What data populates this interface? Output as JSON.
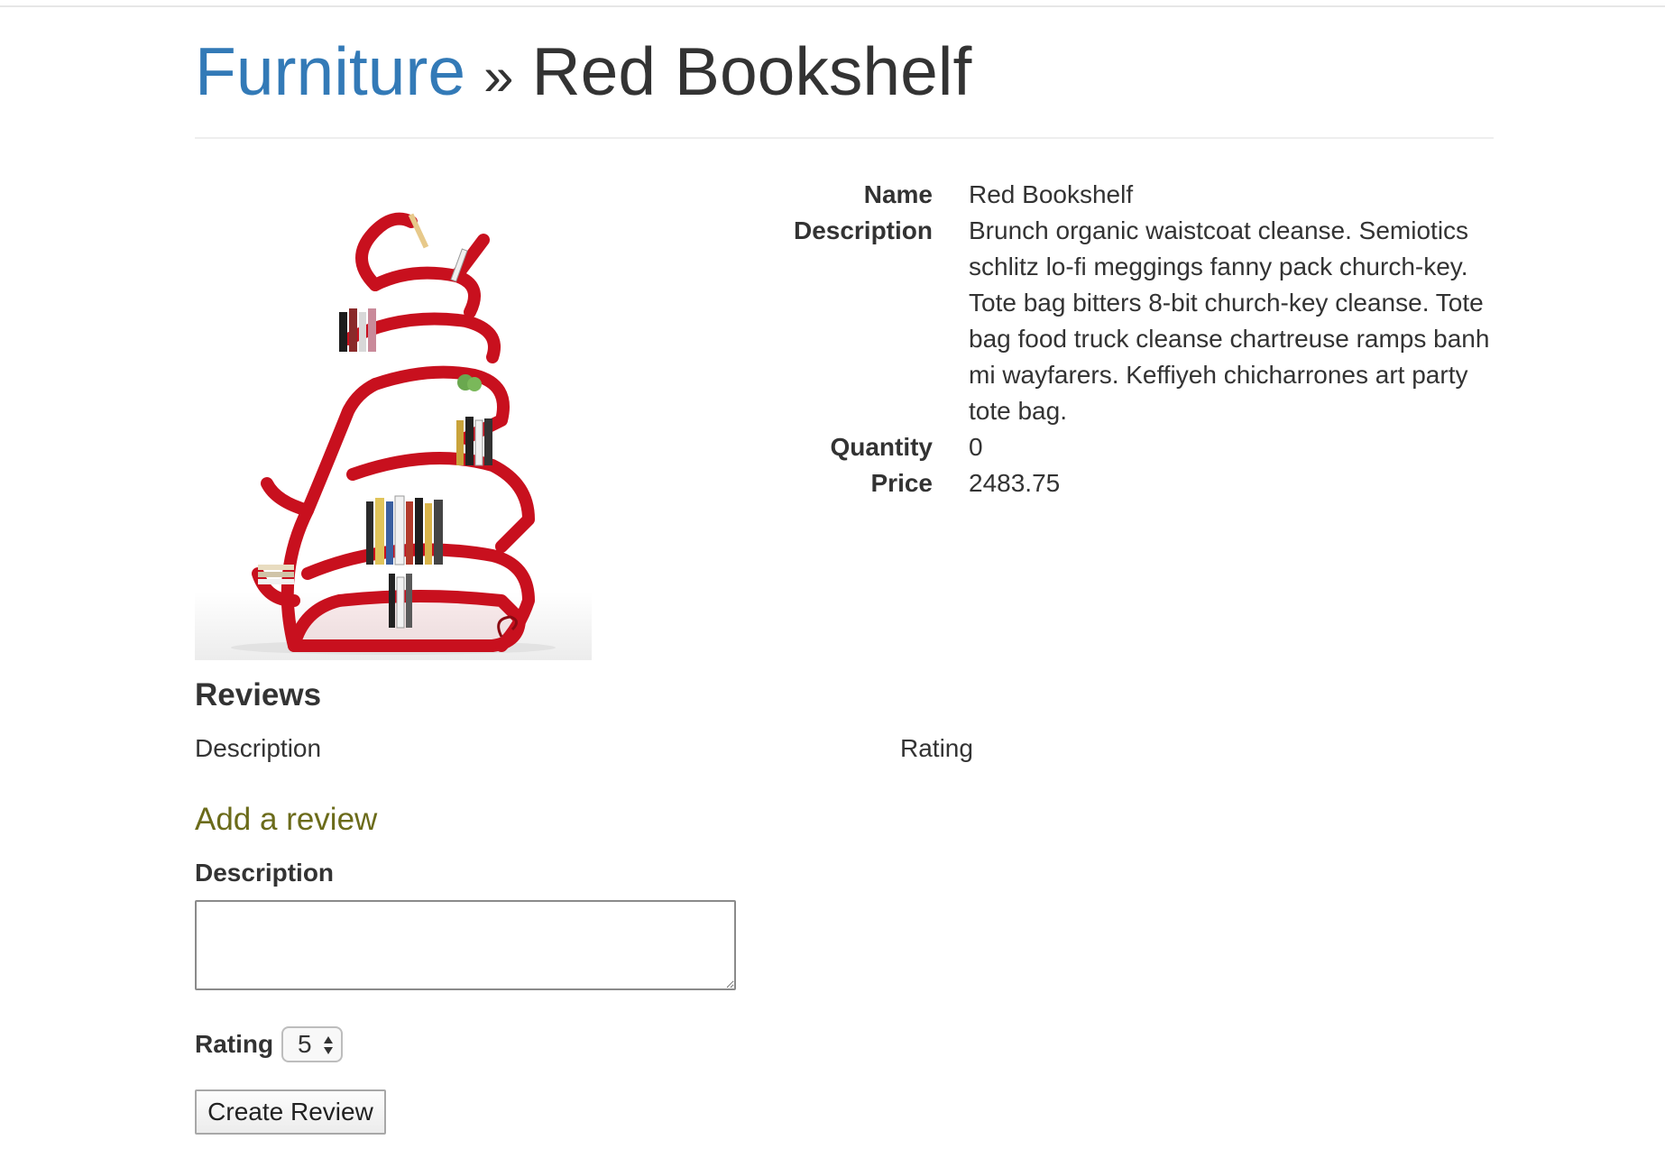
{
  "breadcrumb": {
    "category_link": "Furniture",
    "separator": "»",
    "current": "Red Bookshelf"
  },
  "product": {
    "image_icon": "red-bookshelf-photo",
    "fields": [
      {
        "label": "Name",
        "value": "Red Bookshelf"
      },
      {
        "label": "Description",
        "value": "Brunch organic waistcoat cleanse. Semiotics schlitz lo-fi meggings fanny pack church-key. Tote bag bitters 8-bit church-key cleanse. Tote bag food truck cleanse chartreuse ramps banh mi wayfarers. Keffiyeh chicharrones art party tote bag."
      },
      {
        "label": "Quantity",
        "value": "0"
      },
      {
        "label": "Price",
        "value": "2483.75"
      }
    ]
  },
  "reviews": {
    "heading": "Reviews",
    "columns": {
      "description": "Description",
      "rating": "Rating"
    }
  },
  "add_review": {
    "heading": "Add a review",
    "description_label": "Description",
    "description_value": "",
    "rating_label": "Rating",
    "rating_value": "5",
    "submit_label": "Create Review"
  },
  "colors": {
    "link": "#337ab7",
    "add_review_heading": "#6b6b1a",
    "bookshelf_red": "#c8101e"
  }
}
